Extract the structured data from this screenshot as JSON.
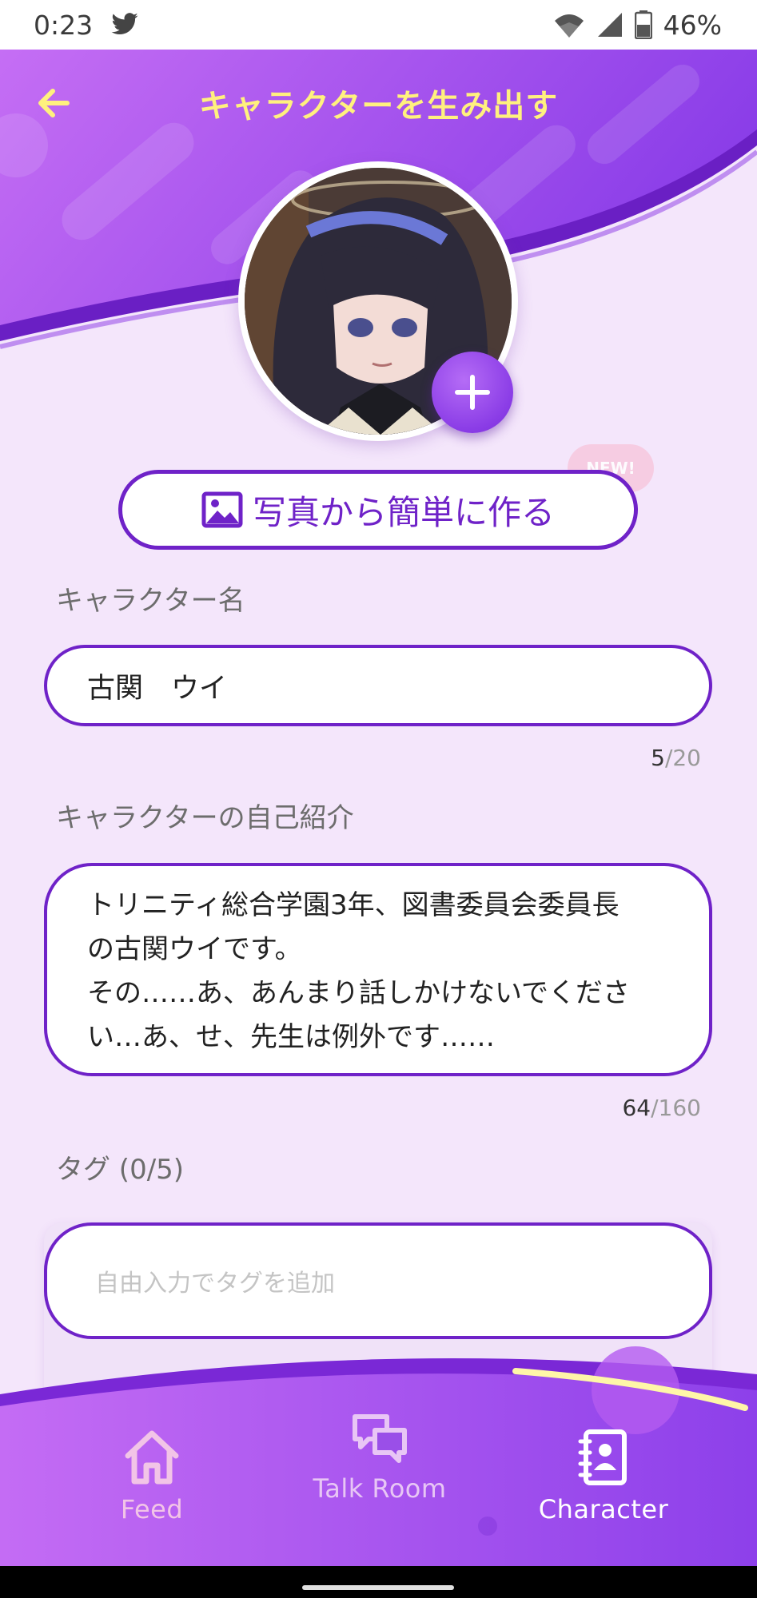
{
  "status_bar": {
    "time": "0:23",
    "battery": "46%",
    "icons": [
      "twitter-icon",
      "wifi-icon",
      "signal-icon",
      "battery-icon"
    ]
  },
  "header": {
    "title": "キャラクターを生み出す",
    "back_icon": "arrow-left-icon"
  },
  "avatar": {
    "add_icon": "plus-icon"
  },
  "photo_button": {
    "label": "写真から簡単に作る",
    "icon": "image-icon",
    "badge": "NEW!"
  },
  "form": {
    "name": {
      "label": "キャラクター名",
      "value": "古関　ウイ",
      "count": "5",
      "max": "/20"
    },
    "bio": {
      "label": "キャラクターの自己紹介",
      "lines": [
        "トリニティ総合学園3年、図書委員会委員長",
        "の古関ウイです。",
        "その……あ、あんまり話しかけないでくださ",
        "い…あ、せ、先生は例外です……"
      ],
      "count": "64",
      "max": "/160"
    },
    "tags": {
      "label": "タグ (0/5)",
      "placeholder": "自由入力でタグを追加"
    }
  },
  "bottom_nav": {
    "items": [
      {
        "label": "Feed",
        "icon": "home-icon",
        "active": false
      },
      {
        "label": "Talk Room",
        "icon": "chat-bubbles-icon",
        "active": false
      },
      {
        "label": "Character",
        "icon": "contact-book-icon",
        "active": true
      }
    ]
  },
  "colors": {
    "primary": "#6f22c8",
    "header_gradient_start": "#c26cf3",
    "header_gradient_end": "#8b3ee8",
    "title_yellow": "#fff17e",
    "background": "#f4e6fb"
  }
}
